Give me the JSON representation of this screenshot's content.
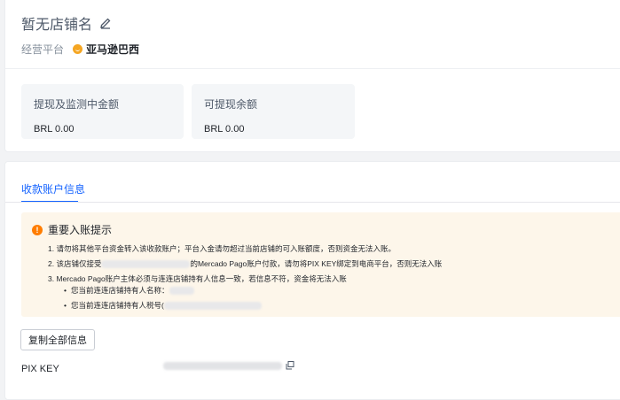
{
  "header": {
    "store_name": "暂无店铺名",
    "platform_label": "经营平台",
    "platform_name": "亚马逊巴西"
  },
  "stats": [
    {
      "label": "提现及监测中金额",
      "value": "BRL 0.00"
    },
    {
      "label": "可提现余额",
      "value": "BRL 0.00"
    }
  ],
  "tabs": {
    "active": "收款账户信息"
  },
  "notice": {
    "title": "重要入账提示",
    "items": [
      "1. 请勿将其他平台资金转入该收款账户；平台入金请勿超过当前店铺的可入账额度，否则资金无法入账。",
      {
        "before": "2. 该店铺仅接受",
        "after": "的Mercado Pago账户付款，请勿将PIX KEY绑定到电商平台，否则无法入账"
      },
      "3. Mercado Pago账户主体必须与连连店铺持有人信息一致，若信息不符，资金将无法入账"
    ],
    "subitems": [
      "您当前连连店铺持有人名称：",
      "您当前连连店铺持有人税号("
    ]
  },
  "actions": {
    "copy_all": "复制全部信息"
  },
  "pix": {
    "label": "PIX KEY"
  },
  "colors": {
    "accent": "#1664ff",
    "notice_bg": "#fdf6ea",
    "warning": "#ff7d00"
  },
  "icons": [
    "edit-icon",
    "amazon-icon",
    "warning-icon",
    "copy-icon"
  ]
}
